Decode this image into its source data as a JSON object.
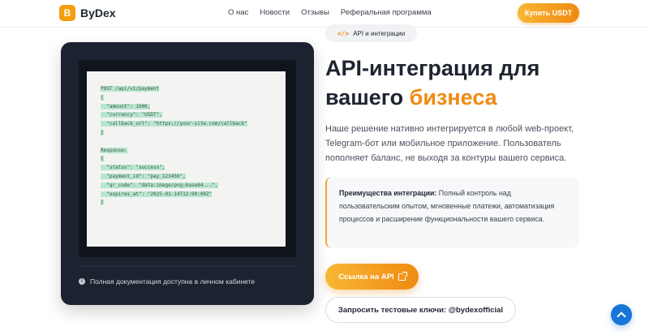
{
  "brand": {
    "logo_letter": "B",
    "name": "ByDex",
    "accent": "#f08a12"
  },
  "nav": {
    "items": [
      "О нас",
      "Новости",
      "Отзывы",
      "Реферальная программа"
    ],
    "buy_label": "Купить USDT"
  },
  "code": {
    "lines": [
      "POST /api/v1/payment",
      "{",
      "  \"amount\": 1000,",
      "  \"currency\": \"USDT\",",
      "  \"callback_url\": \"https://your-site.com/callback\"",
      "}",
      "",
      "Response:",
      "{",
      "  \"status\": \"success\",",
      "  \"payment_id\": \"pay_123456\",",
      "  \"qr_code\": \"data:image/png;base64...\",",
      "  \"expires_at\": \"2025-01-14T12:00:00Z\"",
      "}"
    ],
    "note": "Полная документация доступна в личном кабинете"
  },
  "section": {
    "tag": "API и интеграции",
    "title_main": "API-интеграция для вашего ",
    "title_accent": "бизнеса",
    "description": "Наше решение нативно интегрируется в любой web-проект, Telegram-бот или мобильное приложение. Пользователь пополняет баланс, не выходя за контуры вашего сервиса.",
    "benefits_label": "Преимущества интеграции:",
    "benefits_text": " Полный контроль над пользовательским опытом, мгновенные платежи, автоматизация процессов и расширение функциональности вашего сервиса.",
    "api_button": "Ссылка на API",
    "keys_button": "Запросить тестовые ключи: @bydexofficial"
  }
}
